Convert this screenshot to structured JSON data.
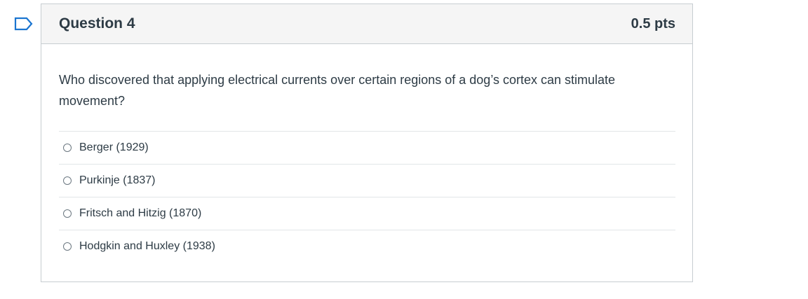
{
  "flag": {
    "icon": "flag-question-icon",
    "color": "#1b75d0"
  },
  "question": {
    "title": "Question 4",
    "points": "0.5 pts",
    "text": "Who discovered that applying electrical currents over certain regions of a dog’s cortex can stimulate movement?",
    "answers": [
      {
        "label": "Berger (1929)",
        "selected": false
      },
      {
        "label": "Purkinje (1837)",
        "selected": false
      },
      {
        "label": "Fritsch and Hitzig (1870)",
        "selected": false
      },
      {
        "label": "Hodgkin and Huxley (1938)",
        "selected": false
      }
    ]
  },
  "colors": {
    "header_bg": "#f5f5f5",
    "border": "#c7cdd1",
    "text": "#2d3b45",
    "flag_accent": "#1b75d0"
  }
}
